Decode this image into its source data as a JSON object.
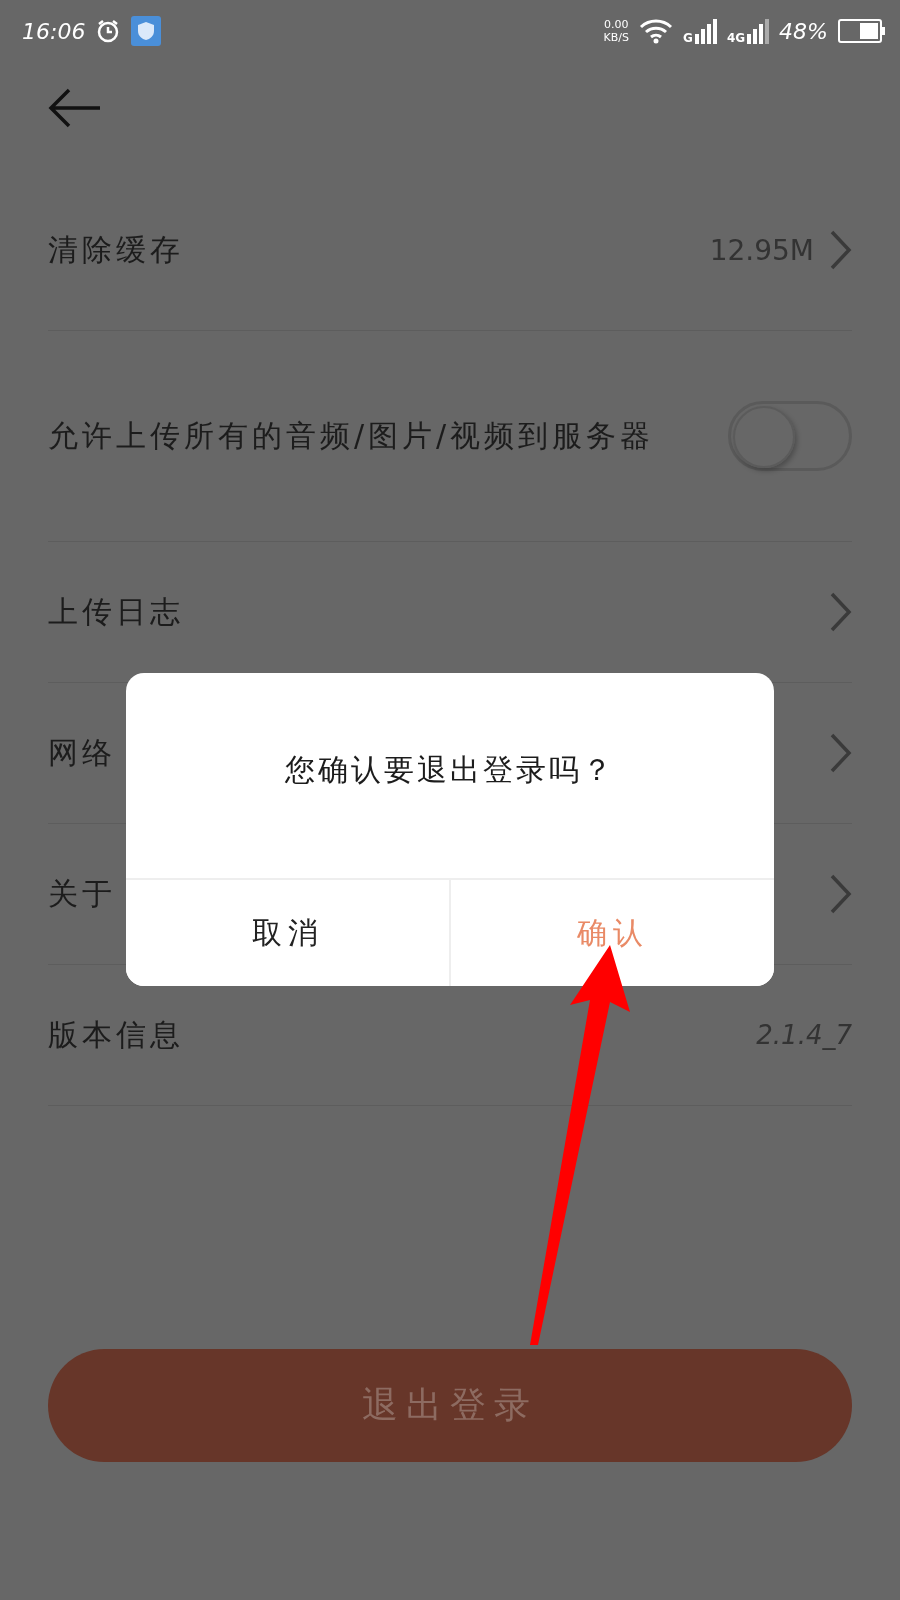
{
  "status_bar": {
    "time": "16:06",
    "speed_value": "0.00",
    "speed_unit": "KB/S",
    "network_1": "G",
    "network_2": "4G",
    "battery": "48%"
  },
  "settings": [
    {
      "kind": "link",
      "label": "清除缓存",
      "value": "12.95M"
    },
    {
      "kind": "toggle",
      "label": "允许上传所有的音频/图片/视频到服务器",
      "on": false
    },
    {
      "kind": "link",
      "label": "上传日志"
    },
    {
      "kind": "link",
      "label": "网络"
    },
    {
      "kind": "link",
      "label": "关于"
    },
    {
      "kind": "info",
      "label": "版本信息",
      "value": "2.1.4_7"
    }
  ],
  "logout_button": "退出登录",
  "dialog": {
    "message": "您确认要退出登录吗？",
    "buttons": [
      {
        "kind": "cancel",
        "label": "取消"
      },
      {
        "kind": "confirm",
        "label": "确认"
      }
    ]
  }
}
